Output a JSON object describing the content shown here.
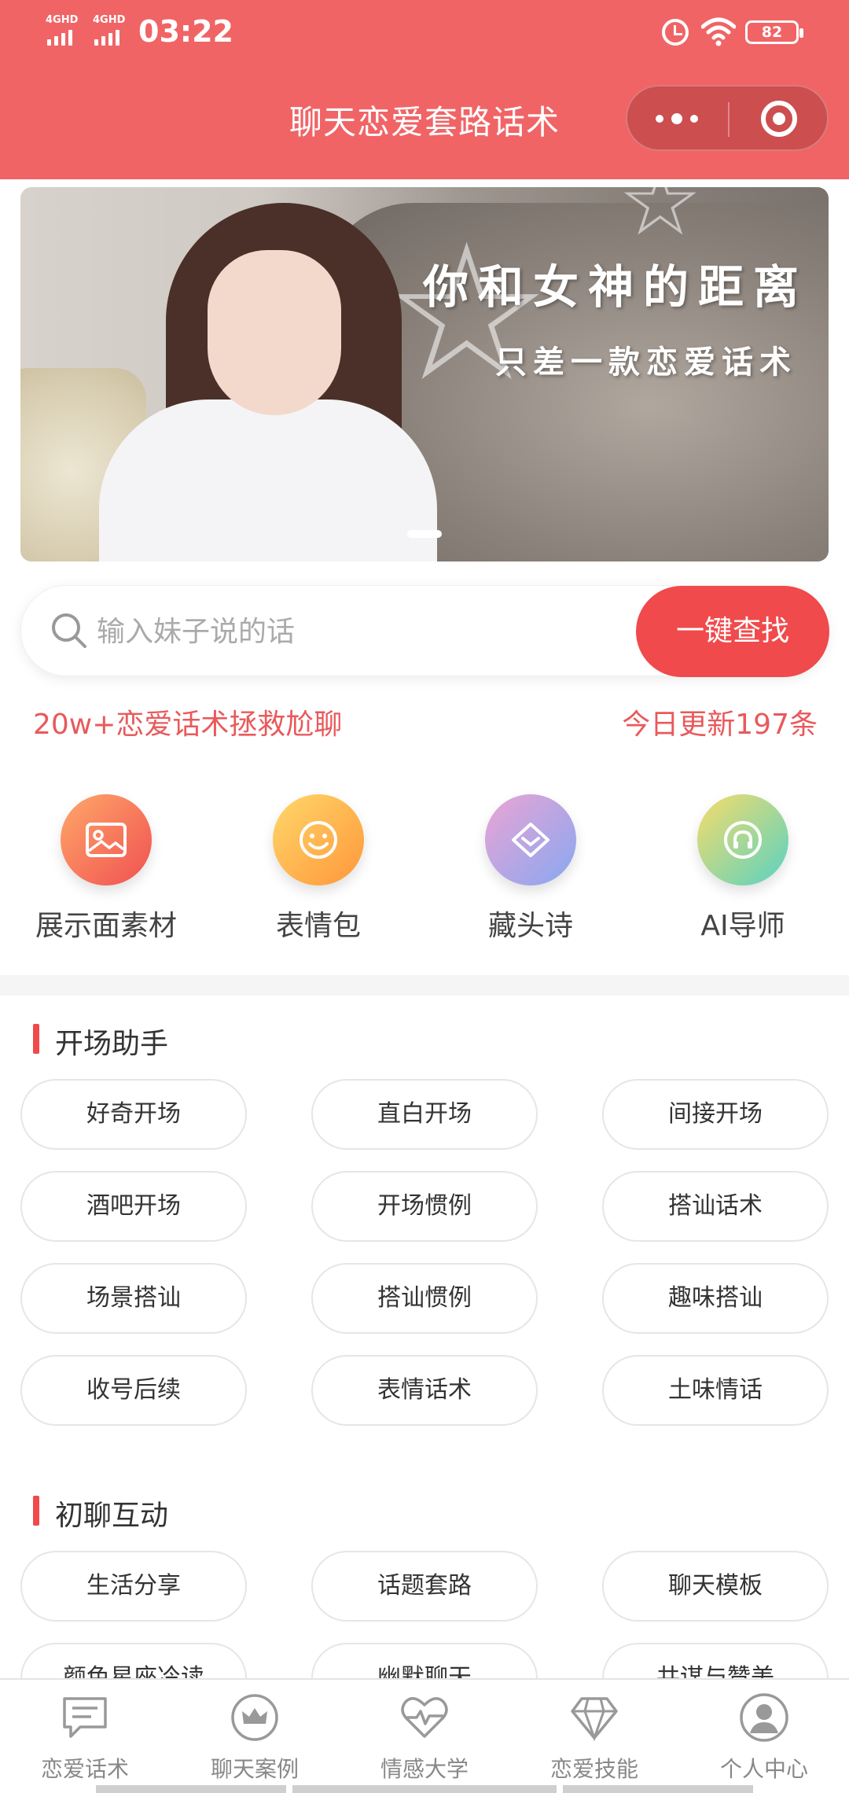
{
  "status_bar": {
    "network_1": "4GHD",
    "network_2": "4GHD",
    "time": "03:22",
    "battery": "82"
  },
  "header": {
    "title": "聊天恋爱套路话术"
  },
  "banner": {
    "headline": "你和女神的距离",
    "subline": "只差一款恋爱话术"
  },
  "search": {
    "placeholder": "输入妹子说的话",
    "button_label": "一键查找"
  },
  "tagline": {
    "left": "20w+恋爱话术拯救尬聊",
    "right": "今日更新197条"
  },
  "quick_links": [
    {
      "label": "展示面素材",
      "icon": "image-icon",
      "color_from": "#ff9a6a",
      "color_to": "#f05a5a"
    },
    {
      "label": "表情包",
      "icon": "smiley-icon",
      "color_from": "#ffd36a",
      "color_to": "#ff9a3a"
    },
    {
      "label": "藏头诗",
      "icon": "diamond-icon",
      "color_from": "#e6a6d8",
      "color_to": "#8aa6f0"
    },
    {
      "label": "AI导师",
      "icon": "headphones-icon",
      "color_from": "#f5d86a",
      "color_to": "#5fd3c0"
    }
  ],
  "sections": [
    {
      "title": "开场助手",
      "items": [
        "好奇开场",
        "直白开场",
        "间接开场",
        "酒吧开场",
        "开场惯例",
        "搭讪话术",
        "场景搭讪",
        "搭讪惯例",
        "趣味搭讪",
        "收号后续",
        "表情话术",
        "土味情话"
      ]
    },
    {
      "title": "初聊互动",
      "items": [
        "生活分享",
        "话题套路",
        "聊天模板",
        "颜色星座冷读",
        "幽默聊天",
        "共谋与赞美"
      ]
    }
  ],
  "bottom_nav": [
    {
      "label": "恋爱话术",
      "icon": "chat-bubble-icon"
    },
    {
      "label": "聊天案例",
      "icon": "crown-icon"
    },
    {
      "label": "情感大学",
      "icon": "heartbeat-icon"
    },
    {
      "label": "恋爱技能",
      "icon": "diamond-icon"
    },
    {
      "label": "个人中心",
      "icon": "user-icon"
    }
  ],
  "colors": {
    "brand": "#f06466",
    "accent": "#f04a4c",
    "tagline": "#e85a5c"
  }
}
